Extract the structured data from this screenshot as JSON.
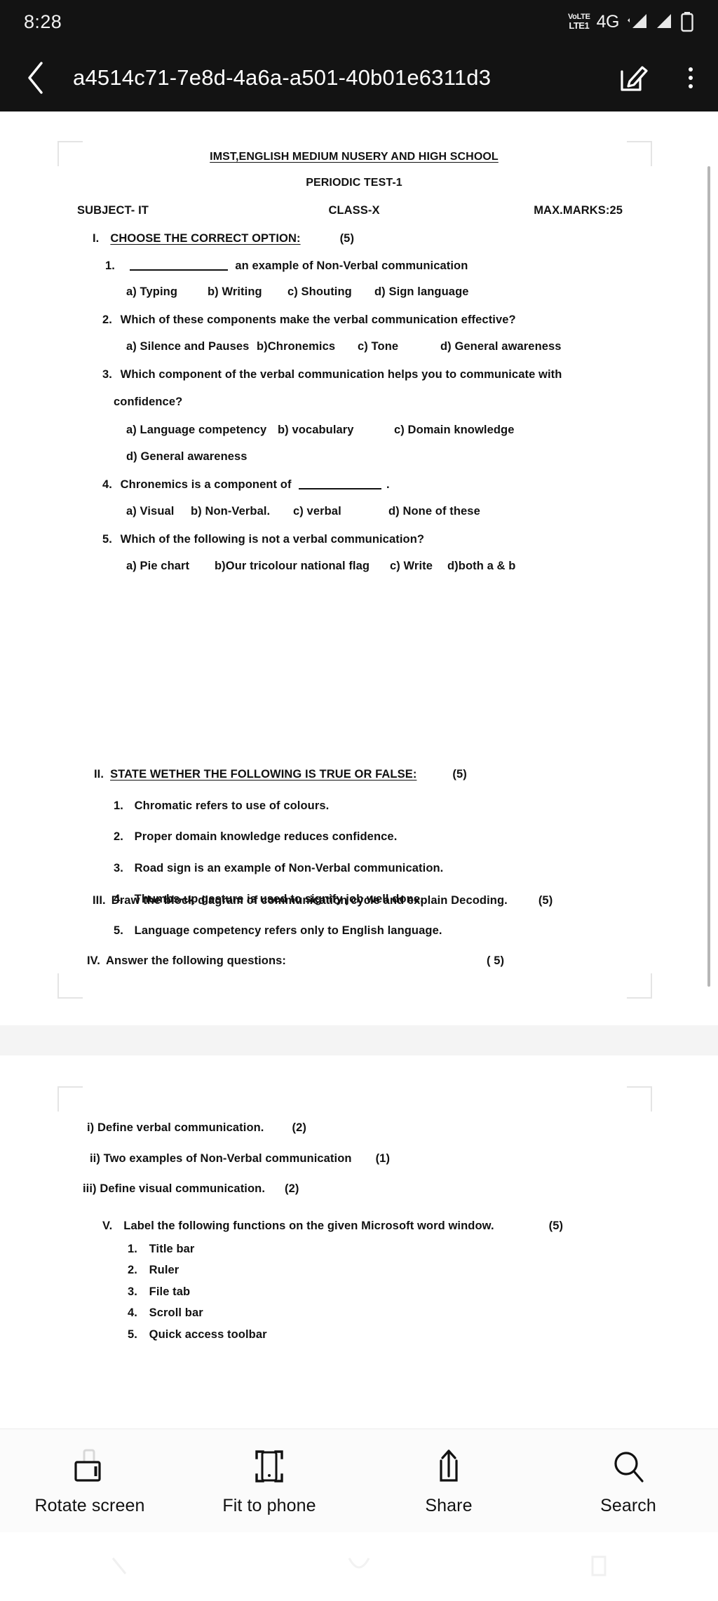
{
  "statusbar": {
    "time": "8:28",
    "volte_top": "VoLTE",
    "volte_bottom": "LTE1",
    "network": "4G",
    "icons": [
      "volte-icon",
      "signal-strength-icon",
      "signal-strength-2-icon",
      "battery-icon"
    ]
  },
  "appbar": {
    "title": "a4514c71-7e8d-4a6a-a501-40b01e6311d3",
    "back_icon": "chevron-left-icon",
    "edit_icon": "edit-pencil-icon",
    "menu_icon": "more-vertical-icon"
  },
  "document": {
    "school": "IMST,ENGLISH MEDIUM NUSERY AND HIGH SCHOOL",
    "test_name": "PERIODIC TEST-1",
    "subject": "SUBJECT- IT",
    "class": "CLASS-X",
    "max_marks": "MAX.MARKS:25",
    "sections": [
      {
        "numeral": "I.",
        "heading": "CHOOSE THE CORRECT OPTION:",
        "marks": "(5)",
        "questions": [
          {
            "number": "1.",
            "pre_blank": true,
            "text": "an example of Non-Verbal communication",
            "options": [
              "a) Typing",
              "b) Writing",
              "c) Shouting",
              "d) Sign language"
            ]
          },
          {
            "number": "2.",
            "text": "Which of these components make the verbal communication effective?",
            "options": [
              "a) Silence and Pauses",
              "b)Chronemics",
              "c) Tone",
              "d) General awareness"
            ]
          },
          {
            "number": "3.",
            "text": "Which component of the verbal communication helps you to communicate with",
            "text2": "confidence?",
            "options": [
              "a) Language competency",
              "b) vocabulary",
              "c) Domain knowledge"
            ],
            "options2": [
              "d) General awareness"
            ]
          },
          {
            "number": "4.",
            "text": "Chronemics is a component of",
            "post_blank": true,
            "text_after": ".",
            "options": [
              "a) Visual",
              "b) Non-Verbal.",
              "c)  verbal",
              "d) None of these"
            ]
          },
          {
            "number": "5.",
            "text": "Which of the following is not a verbal communication?",
            "options": [
              "a)  Pie chart",
              "b)Our tricolour national flag",
              "c) Write",
              "d)both a & b"
            ]
          }
        ]
      },
      {
        "numeral": "II.",
        "heading": "STATE WETHER THE FOLLOWING IS TRUE OR FALSE:",
        "marks": "(5)",
        "statements": [
          {
            "number": "1.",
            "text": "Chromatic refers to use of colours."
          },
          {
            "number": "2.",
            "text": "Proper domain knowledge reduces confidence."
          },
          {
            "number": "3.",
            "text": "Road sign is an example of Non-Verbal communication."
          },
          {
            "number": "4.",
            "text": "Thumbs-up gesture is used to signify job well done."
          },
          {
            "number": "5.",
            "text": "Language competency refers only to English language."
          }
        ]
      },
      {
        "numeral": "III.",
        "heading": "Draw the block diagram of communication cycle and explain Decoding.",
        "marks": "(5)"
      },
      {
        "numeral": "IV.",
        "heading": "Answer the following questions:",
        "marks": "( 5)"
      }
    ],
    "page2_items": [
      {
        "label": "i) Define verbal communication.",
        "marks": "(2)"
      },
      {
        "label": "ii) Two examples of Non-Verbal communication",
        "marks": "(1)"
      },
      {
        "label": "iii) Define visual communication.",
        "marks": "(2)"
      }
    ],
    "section_v": {
      "numeral": "V.",
      "heading": "Label the following functions on the given Microsoft word window.",
      "marks": "(5)",
      "items": [
        {
          "number": "1.",
          "text": "Title bar"
        },
        {
          "number": "2.",
          "text": "Ruler"
        },
        {
          "number": "3.",
          "text": "File tab"
        },
        {
          "number": "4.",
          "text": "Scroll bar"
        },
        {
          "number": "5.",
          "text": "Quick access toolbar"
        }
      ]
    }
  },
  "toolbar": {
    "items": [
      {
        "label": "Rotate screen",
        "icon": "rotate-screen-icon"
      },
      {
        "label": "Fit to phone",
        "icon": "fit-to-phone-icon"
      },
      {
        "label": "Share",
        "icon": "share-icon"
      },
      {
        "label": "Search",
        "icon": "search-icon"
      }
    ]
  },
  "navbar": {
    "items": [
      {
        "icon": "nav-back-icon"
      },
      {
        "icon": "nav-home-icon"
      },
      {
        "icon": "nav-recents-icon"
      }
    ]
  },
  "colors": {
    "bar_background": "#131313",
    "page_background": "#ffffff",
    "text": "#111111",
    "toolbar_background": "#fbfbfb",
    "scrollbar": "#b6b6b6"
  }
}
